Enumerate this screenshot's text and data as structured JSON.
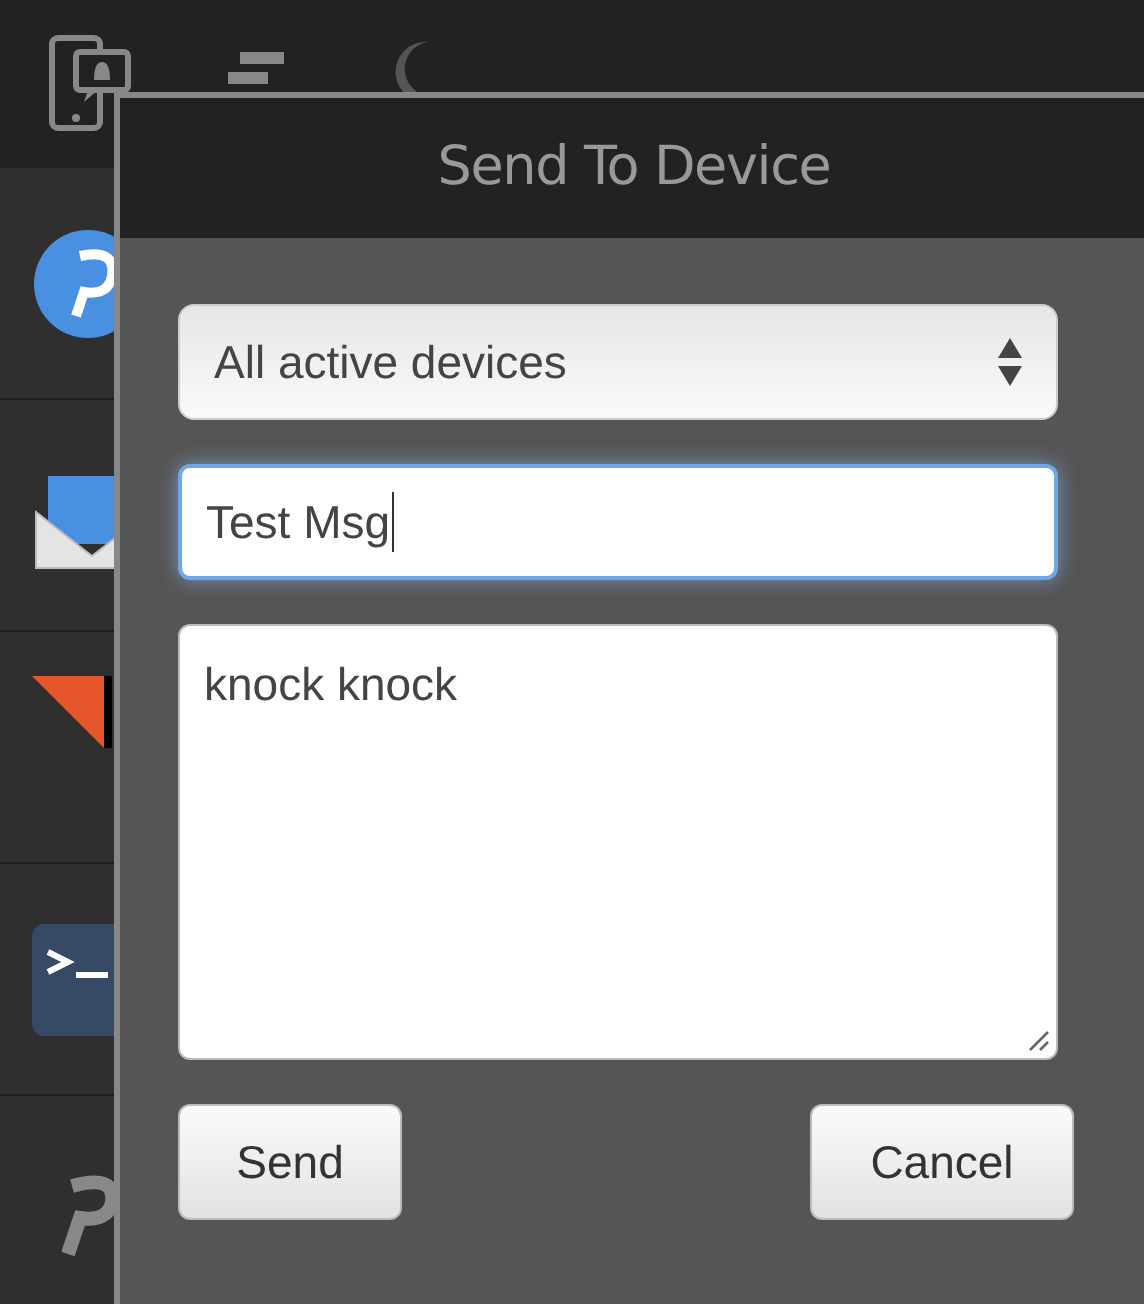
{
  "dialog": {
    "title": "Send To Device",
    "device_select": {
      "value": "All active devices"
    },
    "title_field": {
      "value": "Test Msg",
      "focused": true
    },
    "message_field": {
      "value": "knock knock",
      "focused": false
    },
    "buttons": [
      {
        "label": "Send"
      },
      {
        "label": "Cancel"
      }
    ]
  }
}
